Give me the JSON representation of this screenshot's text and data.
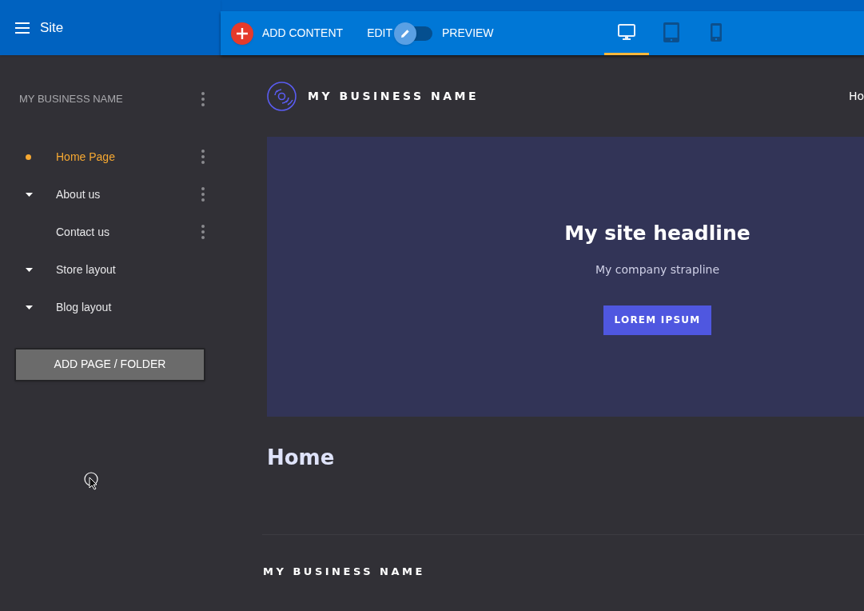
{
  "topbar": {
    "title": "Site",
    "add_content": "ADD CONTENT",
    "edit_label": "EDIT",
    "preview_label": "PREVIEW",
    "preview_on": false,
    "devices": [
      {
        "kind": "desktop",
        "selected": true
      },
      {
        "kind": "tablet",
        "selected": false
      },
      {
        "kind": "phone",
        "selected": false
      }
    ]
  },
  "sidebar": {
    "site_name": "MY BUSINESS NAME",
    "pages": [
      {
        "label": "Home Page",
        "kind": "dot",
        "selected": true,
        "menu": true
      },
      {
        "label": "About us",
        "kind": "caret",
        "selected": false,
        "menu": true
      },
      {
        "label": "Contact us",
        "kind": "plain",
        "selected": false,
        "menu": true
      },
      {
        "label": "Store layout",
        "kind": "caret",
        "selected": false,
        "menu": false
      },
      {
        "label": "Blog layout",
        "kind": "caret",
        "selected": false,
        "menu": false
      }
    ],
    "add_button": "ADD PAGE / FOLDER"
  },
  "preview": {
    "logo_text": "MY BUSINESS NAME",
    "nav_link": "Ho",
    "headline": "My site headline",
    "strapline": "My company strapline",
    "cta": "LOREM IPSUM",
    "page_title": "Home",
    "footer_name": "MY BUSINESS NAME"
  }
}
